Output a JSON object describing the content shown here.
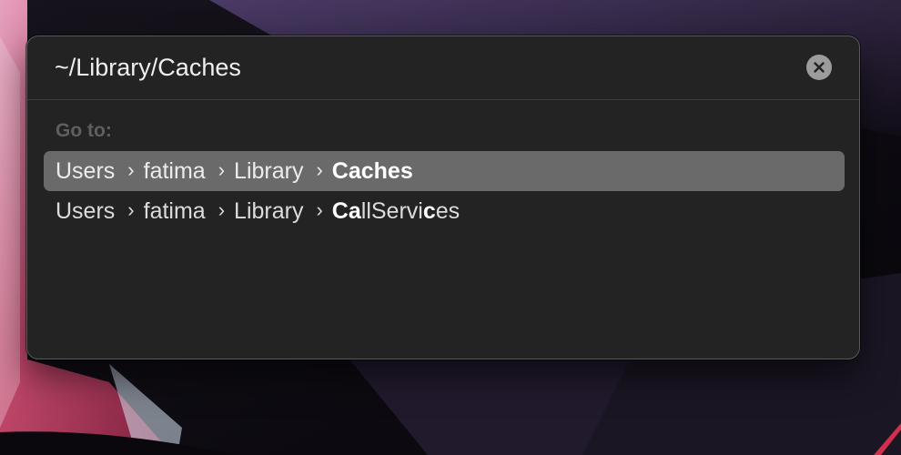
{
  "dialog": {
    "path_value": "~/Library/Caches",
    "clear_icon": "close-circle-icon",
    "goto_label": "Go to:"
  },
  "results": [
    {
      "selected": true,
      "segments": [
        "Users",
        "fatima",
        "Library"
      ],
      "separator_icon": "chevron-right-icon",
      "leaf_parts": [
        {
          "text": "Caches",
          "match": true
        }
      ]
    },
    {
      "selected": false,
      "segments": [
        "Users",
        "fatima",
        "Library"
      ],
      "separator_icon": "chevron-right-icon",
      "leaf_parts": [
        {
          "text": "Ca",
          "match": true
        },
        {
          "text": "llServi",
          "match": false
        },
        {
          "text": "c",
          "match": true
        },
        {
          "text": "es",
          "match": true
        }
      ]
    }
  ],
  "colors": {
    "panel_bg": "#232323",
    "selected_row_bg": "#6a6a6a",
    "label_gray": "#5f5f5f",
    "wallpaper_pink": "#c0476a",
    "wallpaper_purple": "#5b4a7a"
  }
}
